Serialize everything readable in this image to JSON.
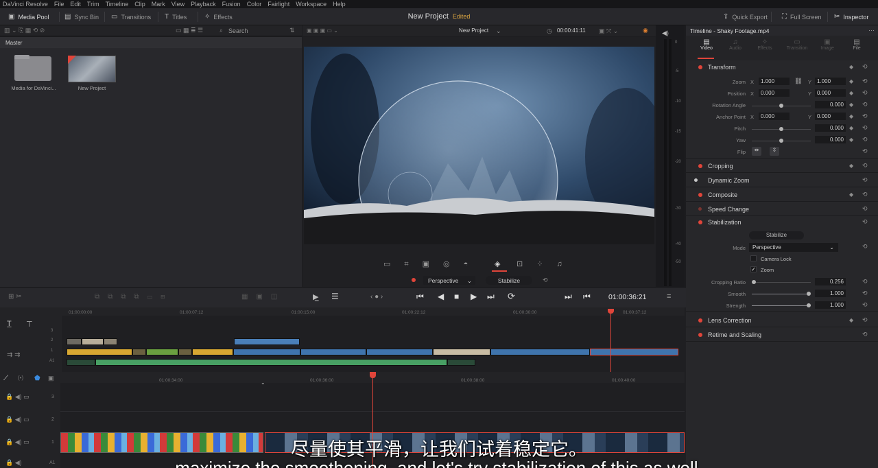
{
  "menu": [
    "DaVinci Resolve",
    "File",
    "Edit",
    "Trim",
    "Timeline",
    "Clip",
    "Mark",
    "View",
    "Playback",
    "Fusion",
    "Color",
    "Fairlight",
    "Workspace",
    "Help"
  ],
  "toolbar": {
    "media_pool": "Media Pool",
    "sync_bin": "Sync Bin",
    "transitions": "Transitions",
    "titles": "Titles",
    "effects": "Effects",
    "quick_export": "Quick Export",
    "full_screen": "Full Screen",
    "inspector": "Inspector"
  },
  "project": {
    "name": "New Project",
    "status": "Edited"
  },
  "media_pool": {
    "search_label": "Search",
    "bin": "Master",
    "items": [
      "Media for DaVinci...",
      "New Project"
    ]
  },
  "viewer": {
    "name": "New Project",
    "timecode": "00:00:41:11",
    "perspective": "Perspective",
    "stabilize": "Stabilize",
    "playhead": "01:00:36:21"
  },
  "meter": {
    "scale": [
      "0",
      "-5",
      "-10",
      "-15",
      "-20",
      "-30",
      "-40",
      "-50"
    ]
  },
  "inspector": {
    "title": "Timeline - Shaky Footage.mp4",
    "tabs": [
      "Video",
      "Audio",
      "Effects",
      "Transition",
      "Image",
      "File"
    ],
    "transform": {
      "title": "Transform",
      "rows": [
        {
          "label": "Zoom",
          "x": "1.000",
          "y": "1.000"
        },
        {
          "label": "Position",
          "x": "0.000",
          "y": "0.000"
        },
        {
          "label": "Rotation Angle",
          "v": "0.000"
        },
        {
          "label": "Anchor Point",
          "x": "0.000",
          "y": "0.000"
        },
        {
          "label": "Pitch",
          "v": "0.000"
        },
        {
          "label": "Yaw",
          "v": "0.000"
        },
        {
          "label": "Flip"
        }
      ],
      "x_label": "X",
      "y_label": "Y"
    },
    "cropping": "Cropping",
    "dynamic_zoom": "Dynamic Zoom",
    "composite": "Composite",
    "speed_change": "Speed Change",
    "stabilization": {
      "title": "Stabilization",
      "button": "Stabilize",
      "mode_label": "Mode",
      "mode": "Perspective",
      "camera_lock": "Camera Lock",
      "zoom": "Zoom",
      "cropping_ratio_label": "Cropping Ratio",
      "cropping_ratio": "0.256",
      "smooth_label": "Smooth",
      "smooth": "1.000",
      "strength_label": "Strength",
      "strength": "1.000"
    },
    "lens_correction": "Lens Correction",
    "retime": "Retime and Scaling"
  },
  "timeline": {
    "upper_ticks": [
      "01:00:00:00",
      "01:00:07:12",
      "01:00:15:00",
      "01:00:22:12",
      "01:00:30:00",
      "01:00:37:12"
    ],
    "lower_ticks": [
      "01:00:34:00",
      "01:00:36:00",
      "01:00:38:00",
      "01:00:40:00"
    ],
    "tracks_upper": [
      "3",
      "2",
      "1",
      "A1"
    ],
    "tracks_lower": [
      "3",
      "2",
      "1",
      "A1"
    ]
  },
  "subtitle": {
    "cn": "尽量使其平滑，让我们试着稳定它。",
    "en": "maximize the smoothening, and let's try stabilization of this as well."
  }
}
